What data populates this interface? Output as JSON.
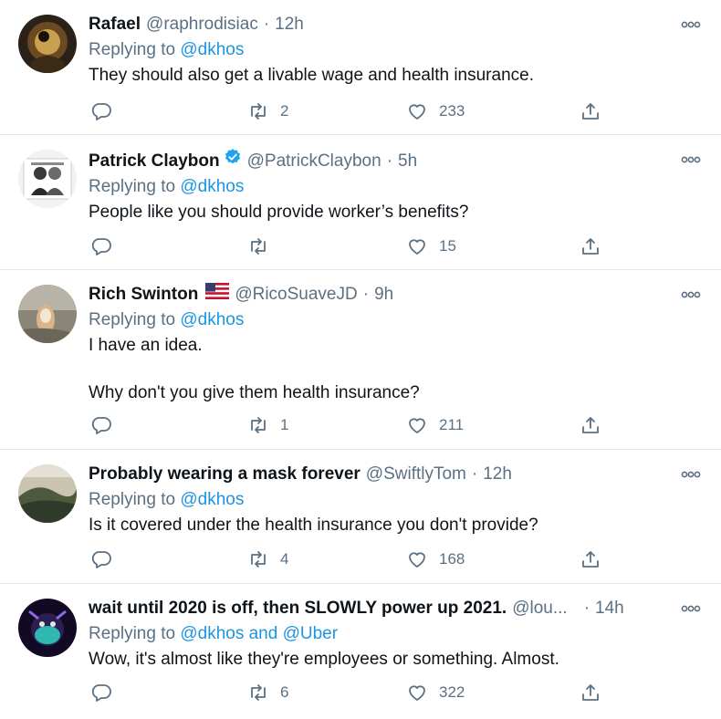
{
  "tweets": [
    {
      "name": "Rafael",
      "handle": "@raphrodisiac",
      "dot": "·",
      "time": "12h",
      "verified": false,
      "flag": false,
      "replying_prefix": "Replying to ",
      "replying_mention": "@dkhos",
      "text": "They should also get a livable wage and health insurance.",
      "retweets": "2",
      "likes": "233"
    },
    {
      "name": "Patrick Claybon",
      "handle": "@PatrickClaybon",
      "dot": "·",
      "time": "5h",
      "verified": true,
      "flag": false,
      "replying_prefix": "Replying to ",
      "replying_mention": "@dkhos",
      "text": "People like you should provide worker’s benefits?",
      "retweets": "",
      "likes": "15"
    },
    {
      "name": "Rich Swinton",
      "handle": "@RicoSuaveJD",
      "dot": "·",
      "time": "9h",
      "verified": false,
      "flag": true,
      "replying_prefix": "Replying to ",
      "replying_mention": "@dkhos",
      "text": "I have an idea.\n\nWhy don't you give them health insurance?",
      "retweets": "1",
      "likes": "211"
    },
    {
      "name": "Probably wearing a mask forever",
      "handle": "@SwiftlyTom",
      "dot": "·",
      "time": "12h",
      "verified": false,
      "flag": false,
      "replying_prefix": "Replying to ",
      "replying_mention": "@dkhos",
      "text": "Is it covered under the health insurance you don't provide?",
      "retweets": "4",
      "likes": "168"
    },
    {
      "name": "wait until 2020 is off, then SLOWLY power up 2021.",
      "handle": "@lou...",
      "dot": "·",
      "time": "14h",
      "verified": false,
      "flag": false,
      "replying_prefix": "Replying to ",
      "replying_mention": "@dkhos and @Uber",
      "text": "Wow, it's almost like they're employees or something. Almost.",
      "retweets": "6",
      "likes": "322"
    }
  ],
  "colors": {
    "text": "#0f1419",
    "secondary": "#5b7083",
    "link": "#1b95e0",
    "verified": "#1da1f2",
    "divider": "#e1e8ed"
  },
  "icons": {
    "reply": "reply-icon",
    "retweet": "retweet-icon",
    "like": "like-icon",
    "share": "share-icon",
    "more": "more-icon",
    "verified": "verified-badge-icon",
    "flag": "us-flag-icon"
  }
}
